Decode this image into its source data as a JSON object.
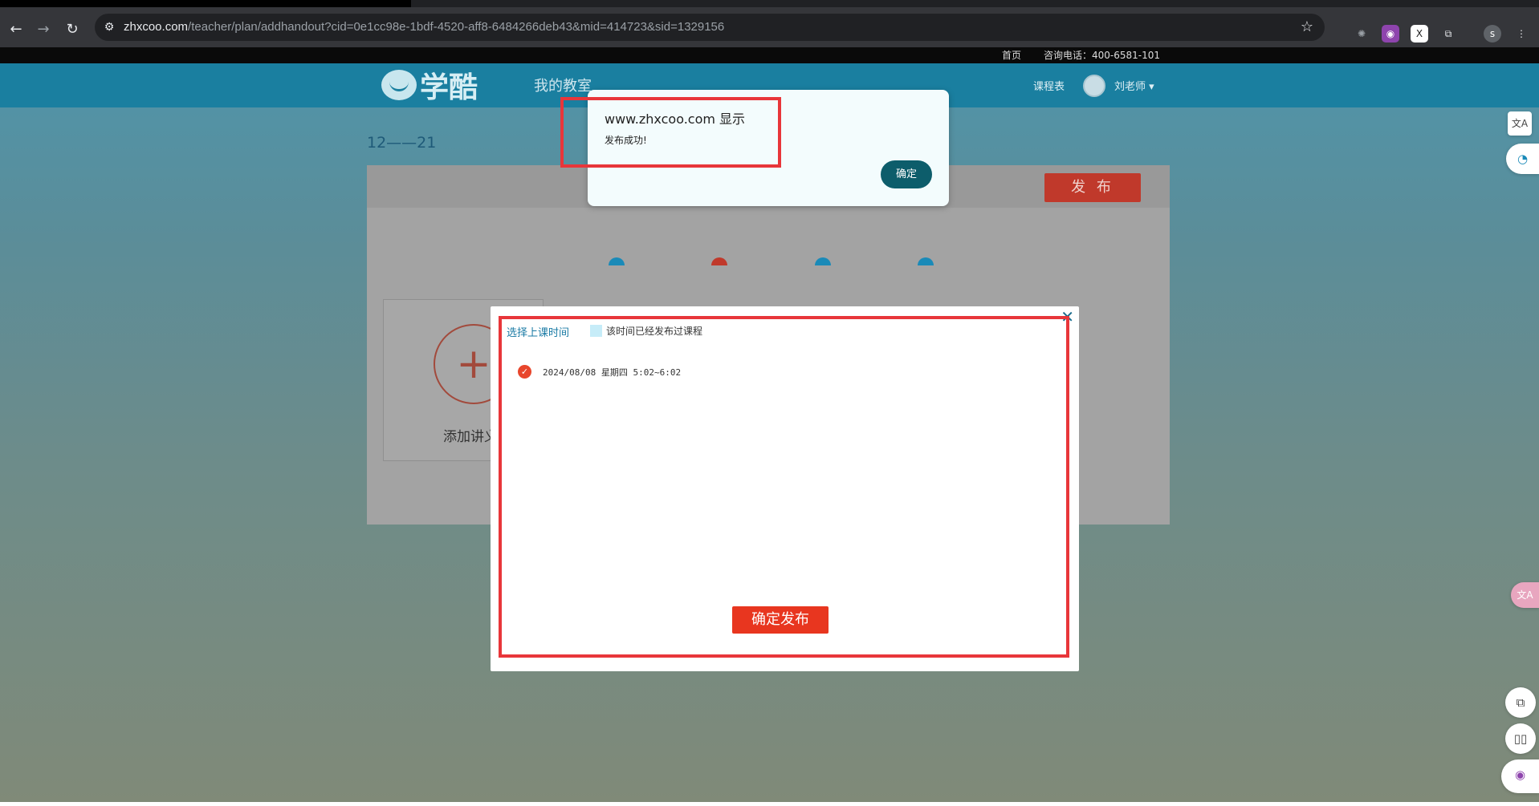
{
  "browser": {
    "url_host": "zhxcoo.com",
    "url_path": "/teacher/plan/addhandout?cid=0e1cc98e-1bdf-4520-aff8-6484266deb43&mid=414723&sid=1329156"
  },
  "site": {
    "top_links": {
      "home": "首页",
      "phone": "咨询电话：400-6581-101"
    },
    "logo_text": "学酷",
    "nav_item": "我的教室",
    "schedule": "课程表",
    "user": "刘老师 ▾"
  },
  "plan": {
    "title": "12——21",
    "publish_label": "发 布",
    "add_label": "添加讲义"
  },
  "modal": {
    "tab_title": "选择上课时间",
    "legend_text": "该时间已经发布过课程",
    "slot_text": "2024/08/08 星期四 5:02~6:02",
    "confirm_label": "确定发布"
  },
  "alert": {
    "host": "www.zhxcoo.com 显示",
    "message": "发布成功!",
    "ok_label": "确定"
  },
  "colors": {
    "accent": "#1a7fa0",
    "danger": "#e8361f",
    "highlight": "#e8363a"
  }
}
